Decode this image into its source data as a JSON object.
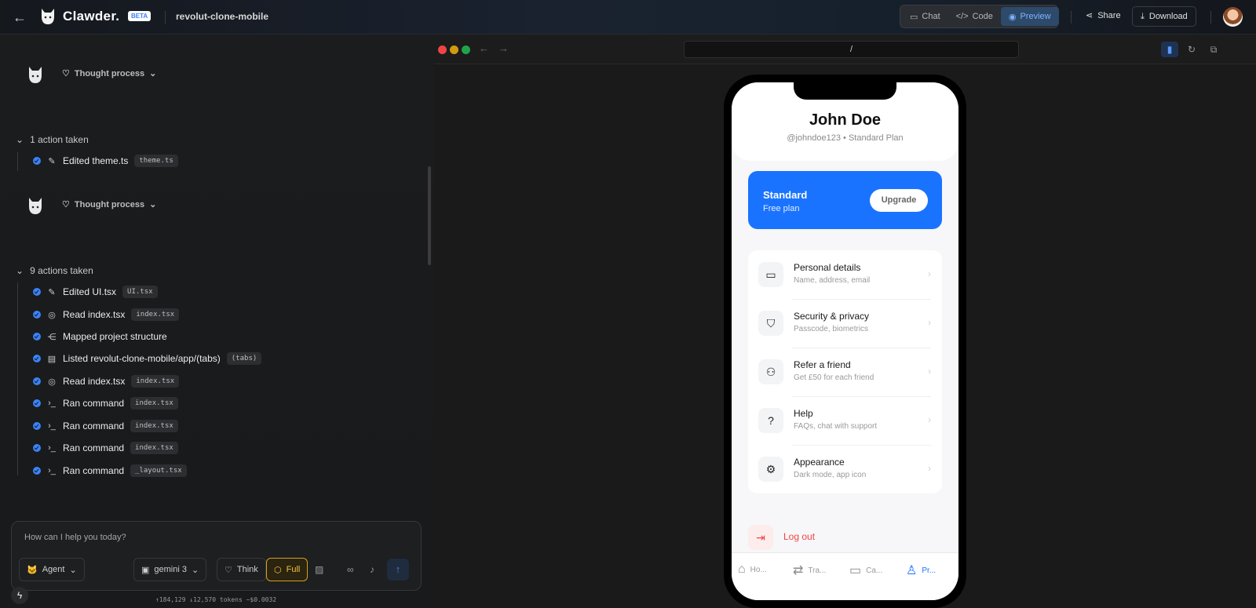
{
  "header": {
    "brand": "Clawder.",
    "badge": "BETA",
    "project": "revolut-clone-mobile",
    "views": [
      {
        "label": "Chat",
        "icon": "chat-icon"
      },
      {
        "label": "Code",
        "icon": "code-icon"
      },
      {
        "label": "Preview",
        "icon": "eye-icon",
        "active": true
      }
    ],
    "share_label": "Share",
    "download_label": "Download"
  },
  "chat": {
    "thought_label": "Thought process",
    "groups": [
      {
        "title": "1 action taken",
        "actions": [
          {
            "label": "Edited theme.ts",
            "icon": "pencil-icon",
            "tag": "theme.ts"
          }
        ]
      },
      {
        "title": "9 actions taken",
        "actions": [
          {
            "label": "Edited UI.tsx",
            "icon": "pencil-icon",
            "tag": "UI.tsx"
          },
          {
            "label": "Read index.tsx",
            "icon": "eye-icon",
            "tag": "index.tsx"
          },
          {
            "label": "Mapped project structure",
            "icon": "nodes-icon",
            "tag": ""
          },
          {
            "label": "Listed revolut-clone-mobile/app/(tabs)",
            "icon": "files-icon",
            "tag": "(tabs)"
          },
          {
            "label": "Read index.tsx",
            "icon": "eye-icon",
            "tag": "index.tsx"
          },
          {
            "label": "Ran command",
            "icon": "terminal-icon",
            "tag": "index.tsx"
          },
          {
            "label": "Ran command",
            "icon": "terminal-icon",
            "tag": "index.tsx"
          },
          {
            "label": "Ran command",
            "icon": "terminal-icon",
            "tag": "index.tsx"
          },
          {
            "label": "Ran command",
            "icon": "terminal-icon",
            "tag": "_layout.tsx"
          }
        ]
      }
    ]
  },
  "composer": {
    "placeholder": "How can I help you today?",
    "agent_label": "Agent",
    "model_label": "gemini 3",
    "think_label": "Think",
    "full_label": "Full",
    "tokens": "↑184,129 ↓12,570 tokens  ~$0.0032"
  },
  "browser": {
    "url": "/"
  },
  "app": {
    "name": "John Doe",
    "subtitle": "@johndoe123 • Standard Plan",
    "plan_title": "Standard",
    "plan_sub": "Free plan",
    "upgrade_label": "Upgrade",
    "menu": [
      {
        "title": "Personal details",
        "sub": "Name, address, email",
        "icon": "card-icon"
      },
      {
        "title": "Security & privacy",
        "sub": "Passcode, biometrics",
        "icon": "shield-icon"
      },
      {
        "title": "Refer a friend",
        "sub": "Get £50 for each friend",
        "icon": "users-icon"
      },
      {
        "title": "Help",
        "sub": "FAQs, chat with support",
        "icon": "help-icon"
      },
      {
        "title": "Appearance",
        "sub": "Dark mode, app icon",
        "icon": "gear-icon"
      }
    ],
    "logout_label": "Log out",
    "tabs": [
      {
        "label": "Ho...",
        "icon": "home-icon"
      },
      {
        "label": "Tra...",
        "icon": "transfer-icon"
      },
      {
        "label": "Ca...",
        "icon": "card-icon"
      },
      {
        "label": "Pr...",
        "icon": "person-icon",
        "active": true
      }
    ]
  },
  "colors": {
    "accent": "#1a73ff",
    "danger": "#ef4444",
    "full_mode": "#f5c13c"
  }
}
